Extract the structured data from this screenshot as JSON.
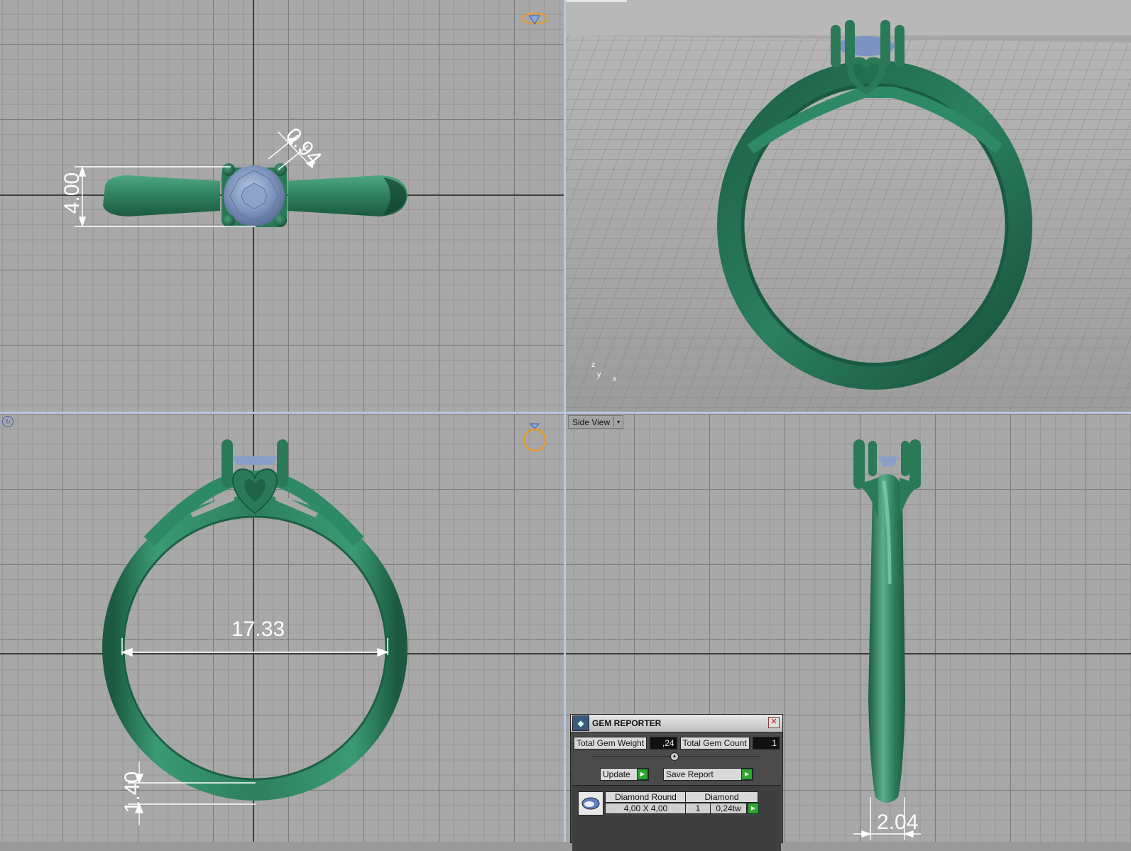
{
  "viewports": {
    "side_view_label": "Side View",
    "dropdown_glyph": "▾"
  },
  "dimensions": {
    "top_height": "4.00",
    "top_prong": "0.94",
    "front_inner_diameter": "17.33",
    "front_band_thickness": "1.40",
    "side_band_width": "2.04"
  },
  "axis_indicator": {
    "z": "z",
    "y": "y",
    "x": "x"
  },
  "gem_reporter": {
    "title": "GEM REPORTER",
    "close_glyph": "✕",
    "total_weight_label": "Total Gem Weight",
    "total_weight_value": ",24",
    "total_count_label": "Total Gem Count",
    "total_count_value": "1",
    "update_label": "Update",
    "save_report_label": "Save Report",
    "play_glyph": "▶",
    "gem": {
      "shape": "Diamond Round",
      "material": "Diamond",
      "size": "4,00 X 4,00",
      "count": "1",
      "weight": "0,24tw"
    }
  },
  "colors": {
    "ring_green": "#2e8060",
    "gem_blue": "#7c92b8",
    "accent_orange": "#e79a2a"
  }
}
